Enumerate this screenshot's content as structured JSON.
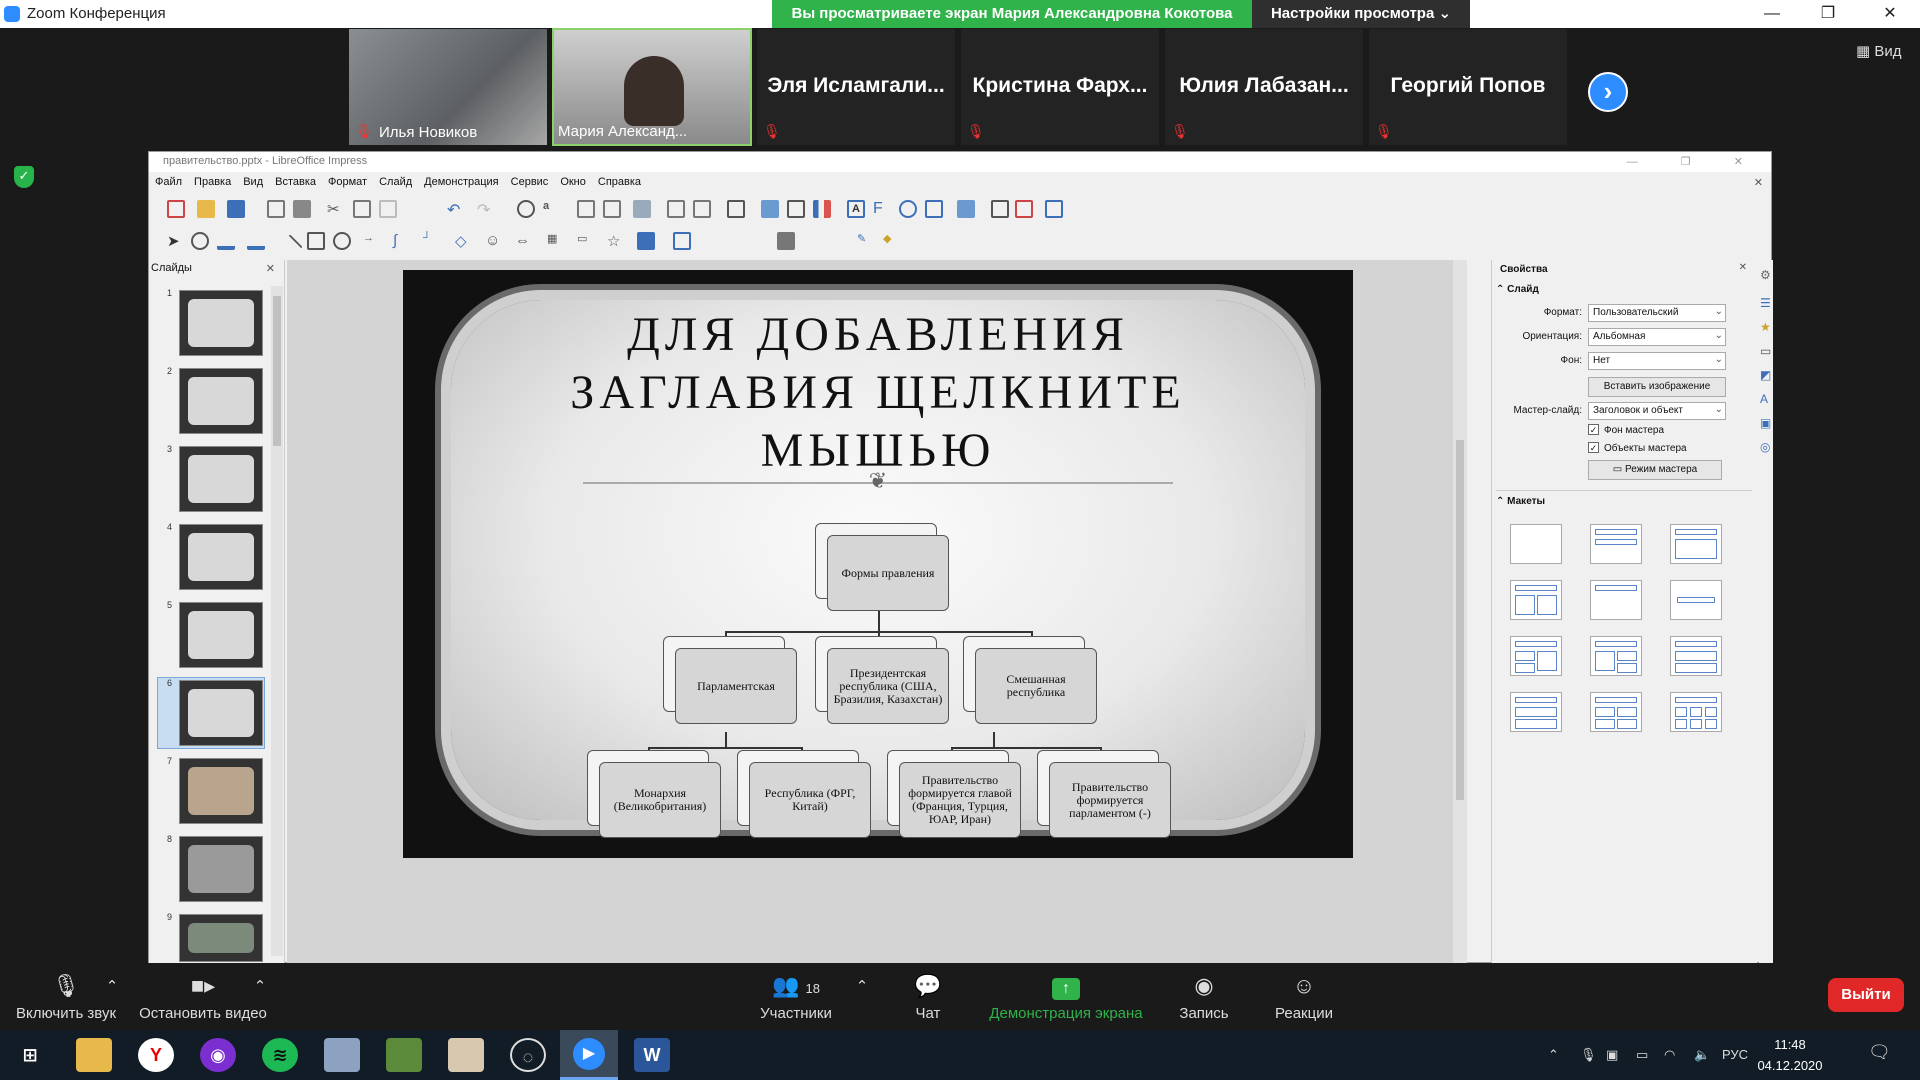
{
  "zoom": {
    "title": "Zoom Конференция",
    "banner": "Вы просматриваете экран Мария Александровна Кокотова",
    "view_settings": "Настройки просмотра ⌄",
    "view_button": "Вид",
    "participants": [
      {
        "name": "Илья Новиков",
        "video": true,
        "muted": true
      },
      {
        "name": "Мария Александ...",
        "video": true,
        "muted": false
      },
      {
        "name": "Эля  Исламгали...",
        "video": false,
        "muted": true
      },
      {
        "name": "Кристина  Фарх...",
        "video": false,
        "muted": true
      },
      {
        "name": "Юлия  Лабазан...",
        "video": false,
        "muted": true
      },
      {
        "name": "Георгий Попов",
        "video": false,
        "muted": true
      }
    ],
    "toolbar": {
      "unmute": "Включить звук",
      "stop_video": "Остановить видео",
      "participants": "Участники",
      "participants_count": "18",
      "chat": "Чат",
      "share": "Демонстрация экрана",
      "record": "Запись",
      "reactions": "Реакции",
      "leave": "Выйти"
    }
  },
  "libreoffice": {
    "title": "правительство.pptx - LibreOffice Impress",
    "menu": [
      "Файл",
      "Правка",
      "Вид",
      "Вставка",
      "Формат",
      "Слайд",
      "Демонстрация",
      "Сервис",
      "Окно",
      "Справка"
    ],
    "slides_panel_title": "Слайды",
    "slide_numbers": [
      "1",
      "2",
      "3",
      "4",
      "5",
      "6",
      "7",
      "8",
      "9"
    ],
    "selected_slide": 6,
    "slide": {
      "title_lines": [
        "ДЛЯ ДОБАВЛЕНИЯ",
        "ЗАГЛАВИЯ ЩЕЛКНИТЕ",
        "МЫШЬЮ"
      ],
      "diagram": {
        "root": "Формы правления",
        "level2": [
          "Парламентская",
          "Президентская республика (США, Бразилия, Казахстан)",
          "Смешанная республика"
        ],
        "level3": [
          "Монархия (Великобритания)",
          "Республика (ФРГ, Китай)",
          "Правительство формируется главой (Франция, Турция, ЮАР, Иран)",
          "Правительство формируется парламентом (-)"
        ]
      }
    },
    "properties": {
      "title": "Свойства",
      "section_slide": "Слайд",
      "format_label": "Формат:",
      "format_value": "Пользовательский",
      "orientation_label": "Ориентация:",
      "orientation_value": "Альбомная",
      "background_label": "Фон:",
      "background_value": "Нет",
      "insert_image": "Вставить изображение",
      "master_label": "Мастер-слайд:",
      "master_value": "Заголовок и объект",
      "master_bg": "Фон мастера",
      "master_objects": "Объекты мастера",
      "master_mode": "Режим мастера",
      "section_layouts": "Макеты"
    }
  },
  "taskbar": {
    "lang": "РУС",
    "time": "11:48",
    "date": "04.12.2020"
  }
}
